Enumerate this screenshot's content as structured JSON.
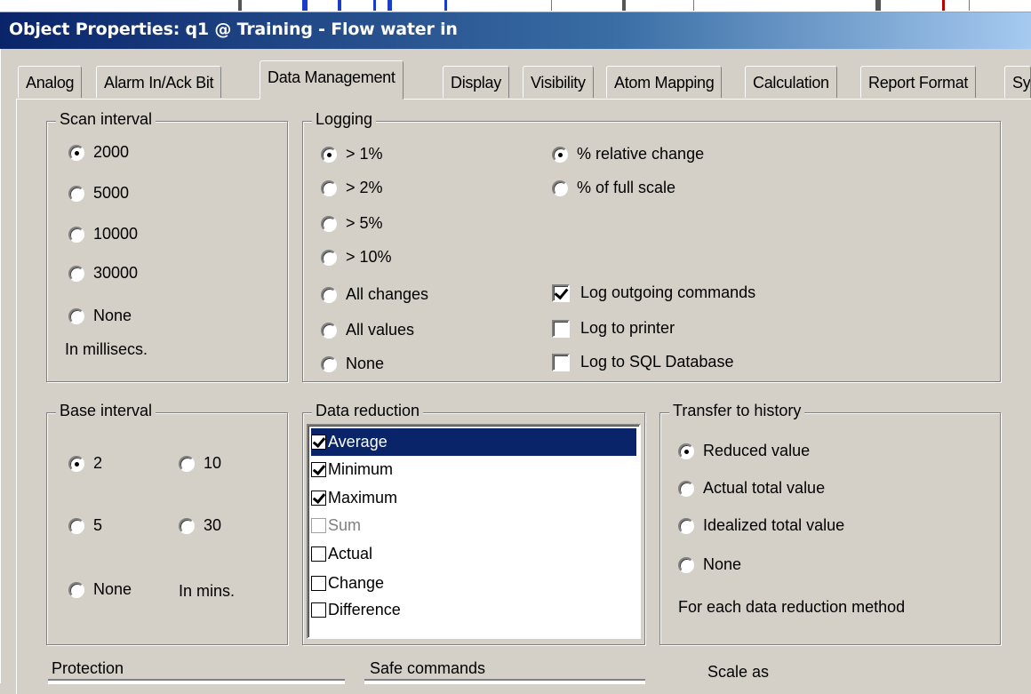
{
  "window": {
    "title": "Object Properties: q1 @ Training - Flow water in"
  },
  "tabs": [
    {
      "label": "Analog"
    },
    {
      "label": "Alarm In/Ack Bit"
    },
    {
      "label": "Data Management"
    },
    {
      "label": "Display"
    },
    {
      "label": "Visibility"
    },
    {
      "label": "Atom Mapping"
    },
    {
      "label": "Calculation"
    },
    {
      "label": "Report Format"
    },
    {
      "label": "Sy"
    }
  ],
  "scan_interval": {
    "legend": "Scan interval",
    "options": [
      "2000",
      "5000",
      "10000",
      "30000",
      "None"
    ],
    "selected": "2000",
    "unit_note": "In millisecs."
  },
  "logging": {
    "legend": "Logging",
    "threshold_options": [
      "> 1%",
      "> 2%",
      "> 5%",
      "> 10%",
      "All changes",
      "All values",
      "None"
    ],
    "threshold_selected": "> 1%",
    "mode_options": [
      "% relative change",
      "% of full scale"
    ],
    "mode_selected": "% relative change",
    "checks": [
      {
        "label": "Log outgoing commands",
        "checked": true
      },
      {
        "label": "Log to printer",
        "checked": false
      },
      {
        "label": "Log to SQL Database",
        "checked": false
      }
    ]
  },
  "base_interval": {
    "legend": "Base interval",
    "options": [
      "2",
      "10",
      "5",
      "30",
      "None"
    ],
    "selected": "2",
    "unit_note": "In mins."
  },
  "data_reduction": {
    "legend": "Data reduction",
    "items": [
      {
        "label": "Average",
        "checked": true,
        "selected": true,
        "enabled": true
      },
      {
        "label": "Minimum",
        "checked": true,
        "selected": false,
        "enabled": true
      },
      {
        "label": "Maximum",
        "checked": true,
        "selected": false,
        "enabled": true
      },
      {
        "label": "Sum",
        "checked": false,
        "selected": false,
        "enabled": false
      },
      {
        "label": "Actual",
        "checked": false,
        "selected": false,
        "enabled": true
      },
      {
        "label": "Change",
        "checked": false,
        "selected": false,
        "enabled": true
      },
      {
        "label": "Difference",
        "checked": false,
        "selected": false,
        "enabled": true
      }
    ]
  },
  "transfer_to_history": {
    "legend": "Transfer to history",
    "options": [
      "Reduced value",
      "Actual total value",
      "Idealized total value",
      "None"
    ],
    "selected": "Reduced value",
    "note": "For each data reduction method"
  },
  "bottom_labels": {
    "protection": "Protection",
    "safe_commands": "Safe commands",
    "scale_as": "Scale as"
  },
  "colors": {
    "face": "#d4d0c8",
    "title_start": "#0a246a",
    "title_end": "#a6caf0",
    "selection": "#0a246a"
  }
}
